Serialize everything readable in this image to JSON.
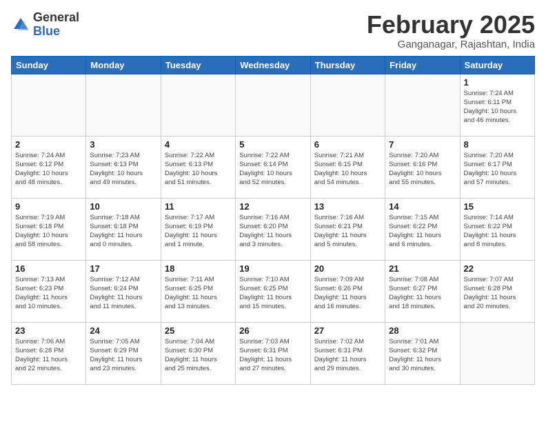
{
  "logo": {
    "general": "General",
    "blue": "Blue"
  },
  "title": "February 2025",
  "subtitle": "Ganganagar, Rajashtan, India",
  "days_header": [
    "Sunday",
    "Monday",
    "Tuesday",
    "Wednesday",
    "Thursday",
    "Friday",
    "Saturday"
  ],
  "weeks": [
    [
      {
        "day": "",
        "info": ""
      },
      {
        "day": "",
        "info": ""
      },
      {
        "day": "",
        "info": ""
      },
      {
        "day": "",
        "info": ""
      },
      {
        "day": "",
        "info": ""
      },
      {
        "day": "",
        "info": ""
      },
      {
        "day": "1",
        "info": "Sunrise: 7:24 AM\nSunset: 6:11 PM\nDaylight: 10 hours\nand 46 minutes."
      }
    ],
    [
      {
        "day": "2",
        "info": "Sunrise: 7:24 AM\nSunset: 6:12 PM\nDaylight: 10 hours\nand 48 minutes."
      },
      {
        "day": "3",
        "info": "Sunrise: 7:23 AM\nSunset: 6:13 PM\nDaylight: 10 hours\nand 49 minutes."
      },
      {
        "day": "4",
        "info": "Sunrise: 7:22 AM\nSunset: 6:13 PM\nDaylight: 10 hours\nand 51 minutes."
      },
      {
        "day": "5",
        "info": "Sunrise: 7:22 AM\nSunset: 6:14 PM\nDaylight: 10 hours\nand 52 minutes."
      },
      {
        "day": "6",
        "info": "Sunrise: 7:21 AM\nSunset: 6:15 PM\nDaylight: 10 hours\nand 54 minutes."
      },
      {
        "day": "7",
        "info": "Sunrise: 7:20 AM\nSunset: 6:16 PM\nDaylight: 10 hours\nand 55 minutes."
      },
      {
        "day": "8",
        "info": "Sunrise: 7:20 AM\nSunset: 6:17 PM\nDaylight: 10 hours\nand 57 minutes."
      }
    ],
    [
      {
        "day": "9",
        "info": "Sunrise: 7:19 AM\nSunset: 6:18 PM\nDaylight: 10 hours\nand 58 minutes."
      },
      {
        "day": "10",
        "info": "Sunrise: 7:18 AM\nSunset: 6:18 PM\nDaylight: 11 hours\nand 0 minutes."
      },
      {
        "day": "11",
        "info": "Sunrise: 7:17 AM\nSunset: 6:19 PM\nDaylight: 11 hours\nand 1 minute."
      },
      {
        "day": "12",
        "info": "Sunrise: 7:16 AM\nSunset: 6:20 PM\nDaylight: 11 hours\nand 3 minutes."
      },
      {
        "day": "13",
        "info": "Sunrise: 7:16 AM\nSunset: 6:21 PM\nDaylight: 11 hours\nand 5 minutes."
      },
      {
        "day": "14",
        "info": "Sunrise: 7:15 AM\nSunset: 6:22 PM\nDaylight: 11 hours\nand 6 minutes."
      },
      {
        "day": "15",
        "info": "Sunrise: 7:14 AM\nSunset: 6:22 PM\nDaylight: 11 hours\nand 8 minutes."
      }
    ],
    [
      {
        "day": "16",
        "info": "Sunrise: 7:13 AM\nSunset: 6:23 PM\nDaylight: 11 hours\nand 10 minutes."
      },
      {
        "day": "17",
        "info": "Sunrise: 7:12 AM\nSunset: 6:24 PM\nDaylight: 11 hours\nand 11 minutes."
      },
      {
        "day": "18",
        "info": "Sunrise: 7:11 AM\nSunset: 6:25 PM\nDaylight: 11 hours\nand 13 minutes."
      },
      {
        "day": "19",
        "info": "Sunrise: 7:10 AM\nSunset: 6:25 PM\nDaylight: 11 hours\nand 15 minutes."
      },
      {
        "day": "20",
        "info": "Sunrise: 7:09 AM\nSunset: 6:26 PM\nDaylight: 11 hours\nand 16 minutes."
      },
      {
        "day": "21",
        "info": "Sunrise: 7:08 AM\nSunset: 6:27 PM\nDaylight: 11 hours\nand 18 minutes."
      },
      {
        "day": "22",
        "info": "Sunrise: 7:07 AM\nSunset: 6:28 PM\nDaylight: 11 hours\nand 20 minutes."
      }
    ],
    [
      {
        "day": "23",
        "info": "Sunrise: 7:06 AM\nSunset: 6:28 PM\nDaylight: 11 hours\nand 22 minutes."
      },
      {
        "day": "24",
        "info": "Sunrise: 7:05 AM\nSunset: 6:29 PM\nDaylight: 11 hours\nand 23 minutes."
      },
      {
        "day": "25",
        "info": "Sunrise: 7:04 AM\nSunset: 6:30 PM\nDaylight: 11 hours\nand 25 minutes."
      },
      {
        "day": "26",
        "info": "Sunrise: 7:03 AM\nSunset: 6:31 PM\nDaylight: 11 hours\nand 27 minutes."
      },
      {
        "day": "27",
        "info": "Sunrise: 7:02 AM\nSunset: 6:31 PM\nDaylight: 11 hours\nand 29 minutes."
      },
      {
        "day": "28",
        "info": "Sunrise: 7:01 AM\nSunset: 6:32 PM\nDaylight: 11 hours\nand 30 minutes."
      },
      {
        "day": "",
        "info": ""
      }
    ]
  ]
}
